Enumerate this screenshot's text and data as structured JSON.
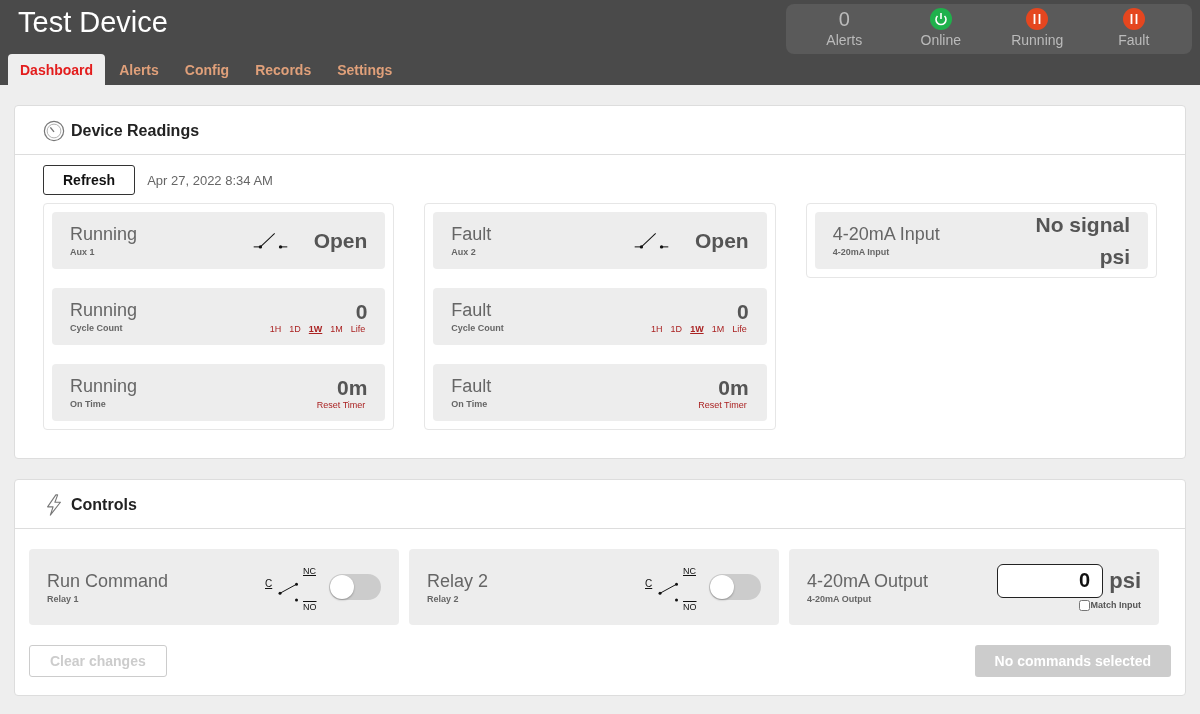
{
  "header": {
    "title": "Test Device",
    "tabs": [
      {
        "label": "Dashboard",
        "selected": true
      },
      {
        "label": "Alerts",
        "selected": false
      },
      {
        "label": "Config",
        "selected": false
      },
      {
        "label": "Records",
        "selected": false
      },
      {
        "label": "Settings",
        "selected": false
      }
    ],
    "status": {
      "alerts_count": "0",
      "alerts_label": "Alerts",
      "indicators": [
        {
          "label": "Online",
          "kind": "power",
          "color": "#1fb14c"
        },
        {
          "label": "Running",
          "kind": "pause",
          "color": "#e5461f"
        },
        {
          "label": "Fault",
          "kind": "pause",
          "color": "#e5461f"
        }
      ]
    }
  },
  "readings": {
    "title": "Device Readings",
    "refresh": "Refresh",
    "timestamp": "Apr 27, 2022 8:34 AM",
    "columns": [
      [
        {
          "kind": "switch",
          "title": "Running",
          "subtitle": "Aux 1",
          "value": "Open"
        },
        {
          "kind": "count",
          "title": "Running",
          "subtitle": "Cycle Count",
          "value": "0",
          "periods": [
            {
              "label": "1H",
              "selected": false
            },
            {
              "label": "1D",
              "selected": false
            },
            {
              "label": "1W",
              "selected": true
            },
            {
              "label": "1M",
              "selected": false
            },
            {
              "label": "Life",
              "selected": false
            }
          ]
        },
        {
          "kind": "timer",
          "title": "Running",
          "subtitle": "On Time",
          "value": "0m",
          "action": "Reset Timer"
        }
      ],
      [
        {
          "kind": "switch",
          "title": "Fault",
          "subtitle": "Aux 2",
          "value": "Open"
        },
        {
          "kind": "count",
          "title": "Fault",
          "subtitle": "Cycle Count",
          "value": "0",
          "periods": [
            {
              "label": "1H",
              "selected": false
            },
            {
              "label": "1D",
              "selected": false
            },
            {
              "label": "1W",
              "selected": true
            },
            {
              "label": "1M",
              "selected": false
            },
            {
              "label": "Life",
              "selected": false
            }
          ]
        },
        {
          "kind": "timer",
          "title": "Fault",
          "subtitle": "On Time",
          "value": "0m",
          "action": "Reset Timer"
        }
      ],
      [
        {
          "kind": "analog",
          "title": "4-20mA Input",
          "subtitle": "4-20mA Input",
          "value": "No signal",
          "unit": "psi"
        }
      ]
    ]
  },
  "controls": {
    "title": "Controls",
    "cards": [
      {
        "kind": "relay",
        "title": "Run Command",
        "subtitle": "Relay 1",
        "c": "C",
        "nc": "NC",
        "no": "NO",
        "on": false
      },
      {
        "kind": "relay",
        "title": "Relay 2",
        "subtitle": "Relay 2",
        "c": "C",
        "nc": "NC",
        "no": "NO",
        "on": false
      },
      {
        "kind": "output",
        "title": "4-20mA Output",
        "subtitle": "4-20mA Output",
        "value": "0",
        "unit": "psi",
        "match_label": "Match Input",
        "match_checked": false
      }
    ],
    "clear": {
      "label": "Clear changes",
      "disabled": true
    },
    "send": {
      "label": "No commands selected",
      "disabled": true
    }
  }
}
